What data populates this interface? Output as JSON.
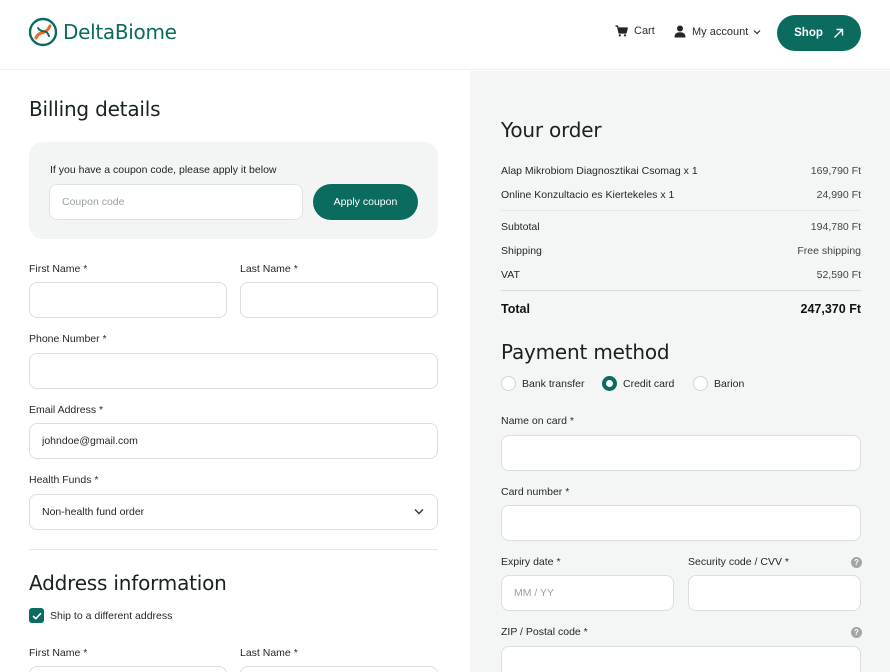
{
  "brand": {
    "name": "DeltaBiome"
  },
  "nav": {
    "cart_label": "Cart",
    "account_label": "My account",
    "shop_label": "Shop"
  },
  "billing": {
    "title": "Billing details",
    "coupon": {
      "hint": "If you have a coupon code, please apply it below",
      "placeholder": "Coupon code",
      "button": "Apply coupon"
    },
    "first_name_label": "First Name *",
    "last_name_label": "Last Name *",
    "phone_label": "Phone Number *",
    "email_label": "Email Address *",
    "email_value": "johndoe@gmail.com",
    "health_funds_label": "Health Funds *",
    "health_funds_value": "Non-health fund order"
  },
  "address": {
    "title": "Address information",
    "ship_different_label": "Ship to a different address",
    "ship_different_checked": true,
    "first_name_label": "First Name *",
    "last_name_label": "Last Name *"
  },
  "order": {
    "title": "Your order",
    "items": [
      {
        "name": "Alap Mikrobiom Diagnosztikai Csomag  x 1",
        "price": "169,790 Ft"
      },
      {
        "name": "Online Konzultacio es Kiertekeles x 1",
        "price": "24,990 Ft"
      }
    ],
    "subtotal_label": "Subtotal",
    "subtotal_value": "194,780 Ft",
    "shipping_label": "Shipping",
    "shipping_value": "Free shipping",
    "vat_label": "VAT",
    "vat_value": "52,590 Ft",
    "total_label": "Total",
    "total_value": "247,370 Ft"
  },
  "payment": {
    "title": "Payment method",
    "options": [
      "Bank transfer",
      "Credit card",
      "Barion"
    ],
    "selected": "Credit card",
    "name_on_card_label": "Name on card *",
    "card_number_label": "Card number *",
    "expiry_label": "Expiry date *",
    "expiry_placeholder": "MM / YY",
    "cvv_label": "Security code / CVV *",
    "zip_label": "ZIP / Postal code *"
  },
  "colors": {
    "accent": "#0b6b5f",
    "panel": "#f3f6f5"
  }
}
